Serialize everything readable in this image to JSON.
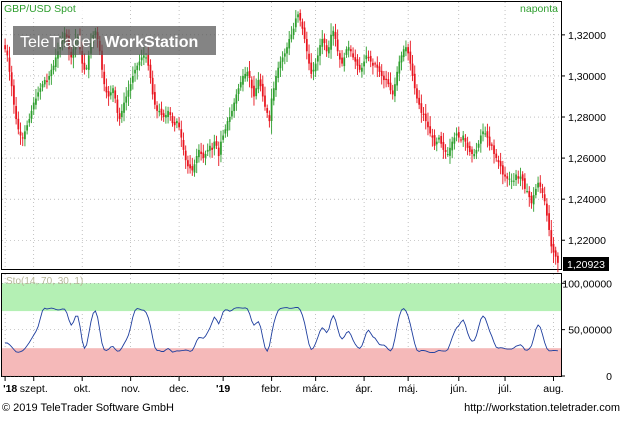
{
  "header": {
    "instrument": "GBP/USD Spot",
    "interval": "naponta",
    "watermark_light": "TeleTrader",
    "watermark_bold": "WorkStation"
  },
  "footer": {
    "copyright": "© 2019 TeleTrader Software GmbH",
    "url": "http://workstation.teletrader.com"
  },
  "colors": {
    "up": "#2e9e2e",
    "down": "#e8141e",
    "price_label_bg": "#000000",
    "stoch_line": "#1f3f9f",
    "overbought_zone": "#b4f0b4",
    "oversold_zone": "#f5b9b9",
    "indicator_label": "#b8b89a"
  },
  "chart_data": [
    {
      "type": "candlestick",
      "title": "GBP/USD Spot",
      "interval": "naponta",
      "last_value_label": "1,20923",
      "last_value": 1.20923,
      "ylim": [
        1.206,
        1.336
      ],
      "y_ticks": [
        1.22,
        1.24,
        1.26,
        1.28,
        1.3,
        1.32
      ],
      "y_tick_labels": [
        "1,22000",
        "1,24000",
        "1,26000",
        "1,28000",
        "1,30000",
        "1,32000"
      ],
      "x_tick_labels": [
        "'18",
        "szept.",
        "okt.",
        "nov.",
        "dec.",
        "'19",
        "febr.",
        "márc.",
        "ápr.",
        "máj.",
        "jún.",
        "júl.",
        "aug."
      ],
      "x_tick_index": [
        0,
        13,
        35,
        57,
        79,
        99,
        121,
        141,
        163,
        183,
        206,
        227,
        249
      ],
      "grid": true,
      "close_series": [
        1.313,
        1.31,
        1.302,
        1.295,
        1.286,
        1.279,
        1.274,
        1.271,
        1.27,
        1.273,
        1.276,
        1.279,
        1.283,
        1.287,
        1.289,
        1.292,
        1.294,
        1.296,
        1.298,
        1.297,
        1.3,
        1.303,
        1.305,
        1.309,
        1.312,
        1.315,
        1.318,
        1.321,
        1.319,
        1.313,
        1.309,
        1.313,
        1.318,
        1.319,
        1.313,
        1.306,
        1.303,
        1.304,
        1.31,
        1.316,
        1.32,
        1.322,
        1.318,
        1.312,
        1.303,
        1.296,
        1.292,
        1.29,
        1.292,
        1.294,
        1.289,
        1.282,
        1.279,
        1.283,
        1.287,
        1.29,
        1.293,
        1.296,
        1.3,
        1.303,
        1.305,
        1.307,
        1.309,
        1.31,
        1.309,
        1.305,
        1.299,
        1.291,
        1.286,
        1.283,
        1.283,
        1.281,
        1.28,
        1.281,
        1.283,
        1.281,
        1.277,
        1.276,
        1.278,
        1.275,
        1.27,
        1.264,
        1.259,
        1.256,
        1.255,
        1.254,
        1.257,
        1.261,
        1.264,
        1.262,
        1.26,
        1.262,
        1.264,
        1.266,
        1.264,
        1.268,
        1.266,
        1.261,
        1.268,
        1.271,
        1.274,
        1.278,
        1.28,
        1.283,
        1.287,
        1.291,
        1.294,
        1.297,
        1.3,
        1.301,
        1.302,
        1.299,
        1.294,
        1.29,
        1.294,
        1.298,
        1.295,
        1.29,
        1.285,
        1.282,
        1.278,
        1.289,
        1.294,
        1.3,
        1.304,
        1.307,
        1.309,
        1.311,
        1.314,
        1.318,
        1.32,
        1.323,
        1.328,
        1.33,
        1.327,
        1.323,
        1.318,
        1.312,
        1.306,
        1.301,
        1.303,
        1.306,
        1.31,
        1.315,
        1.318,
        1.316,
        1.312,
        1.314,
        1.32,
        1.322,
        1.318,
        1.312,
        1.308,
        1.306,
        1.309,
        1.313,
        1.314,
        1.312,
        1.309,
        1.307,
        1.305,
        1.303,
        1.304,
        1.307,
        1.31,
        1.309,
        1.307,
        1.305,
        1.306,
        1.304,
        1.302,
        1.3,
        1.298,
        1.298,
        1.296,
        1.293,
        1.291,
        1.296,
        1.302,
        1.307,
        1.31,
        1.313,
        1.314,
        1.311,
        1.306,
        1.3,
        1.294,
        1.289,
        1.286,
        1.282,
        1.281,
        1.278,
        1.275,
        1.272,
        1.27,
        1.266,
        1.268,
        1.27,
        1.267,
        1.264,
        1.263,
        1.262,
        1.265,
        1.268,
        1.27,
        1.272,
        1.27,
        1.269,
        1.271,
        1.268,
        1.265,
        1.263,
        1.262,
        1.262,
        1.264,
        1.267,
        1.271,
        1.273,
        1.272,
        1.27,
        1.266,
        1.266,
        1.262,
        1.26,
        1.258,
        1.256,
        1.252,
        1.251,
        1.25,
        1.25,
        1.249,
        1.249,
        1.252,
        1.25,
        1.251,
        1.249,
        1.245,
        1.244,
        1.241,
        1.238,
        1.242,
        1.245,
        1.248,
        1.246,
        1.243,
        1.239,
        1.232,
        1.225,
        1.217,
        1.214,
        1.212,
        1.209
      ]
    },
    {
      "type": "line",
      "title": "Sto(14, 70, 30, 1)",
      "series": [
        {
          "name": "Sto(14, 70, 30, 1)"
        }
      ],
      "ylim": [
        0,
        110
      ],
      "y_ticks": [
        0,
        50,
        100
      ],
      "y_tick_labels": [
        "0",
        "50,00000",
        "100,00000"
      ],
      "overbought_level": 70,
      "oversold_level": 30,
      "grid": true
    }
  ]
}
